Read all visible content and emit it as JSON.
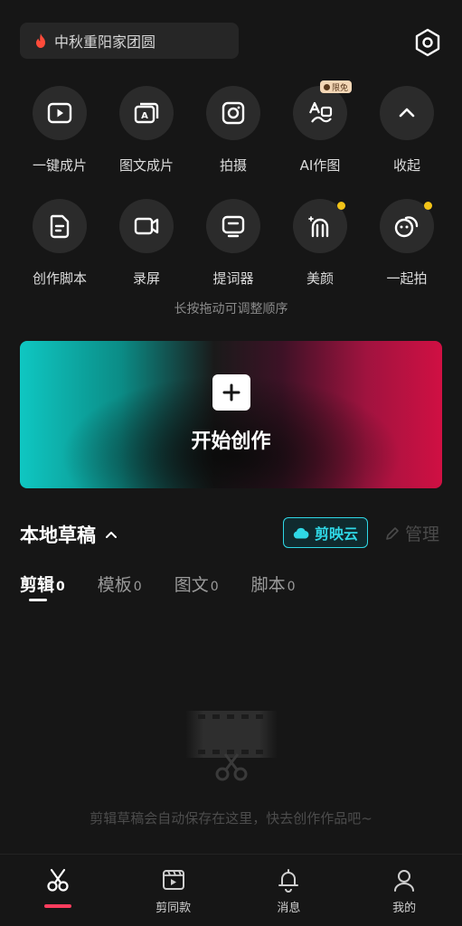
{
  "search": {
    "text": "中秋重阳家团圆",
    "accent": "#ff4b3a"
  },
  "tools_row1": [
    {
      "label": "一键成片",
      "icon": "play-screen-icon"
    },
    {
      "label": "图文成片",
      "icon": "text-to-video-icon"
    },
    {
      "label": "拍摄",
      "icon": "camera-icon"
    },
    {
      "label": "AI作图",
      "icon": "ai-draw-icon",
      "badge": "限免"
    },
    {
      "label": "收起",
      "icon": "chevron-up-icon"
    }
  ],
  "tools_row2": [
    {
      "label": "创作脚本",
      "icon": "script-icon"
    },
    {
      "label": "录屏",
      "icon": "record-screen-icon"
    },
    {
      "label": "提词器",
      "icon": "teleprompter-icon"
    },
    {
      "label": "美颜",
      "icon": "beauty-icon",
      "dot": true
    },
    {
      "label": "一起拍",
      "icon": "shoot-together-icon",
      "dot": true
    }
  ],
  "hint": "长按拖动可调整顺序",
  "create": {
    "label": "开始创作"
  },
  "drafts": {
    "title": "本地草稿",
    "cloud_label": "剪映云",
    "manage_label": "管理",
    "tabs": [
      {
        "name": "剪辑",
        "count": "0",
        "active": true
      },
      {
        "name": "模板",
        "count": "0"
      },
      {
        "name": "图文",
        "count": "0"
      },
      {
        "name": "脚本",
        "count": "0"
      }
    ],
    "empty_text": "剪辑草稿会自动保存在这里，快去创作作品吧~"
  },
  "bottom_nav": [
    {
      "label": "",
      "icon": "scissors-icon",
      "active": true
    },
    {
      "label": "剪同款",
      "icon": "template-clip-icon"
    },
    {
      "label": "消息",
      "icon": "bell-icon"
    },
    {
      "label": "我的",
      "icon": "profile-icon"
    }
  ],
  "colors": {
    "accent_cyan": "#2fd8e6",
    "accent_red": "#ff3d5e",
    "dot_yellow": "#f2c318"
  }
}
